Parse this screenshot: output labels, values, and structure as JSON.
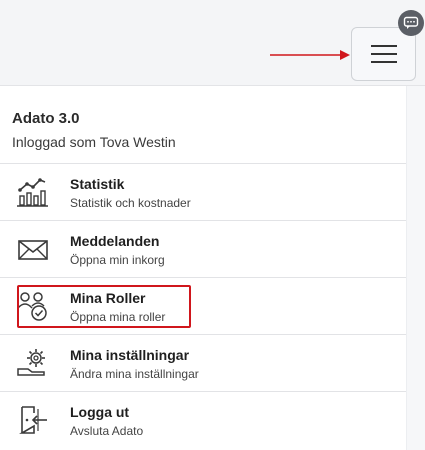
{
  "header": {
    "menu_button": "hamburger-menu",
    "chat_icon": "chat-icon",
    "annotation_arrow_color": "#d0161c"
  },
  "panel": {
    "app_title": "Adato 3.0",
    "logged_in_text": "Inloggad som Tova Westin",
    "items": [
      {
        "title": "Statistik",
        "subtitle": "Statistik och kostnader",
        "icon": "chart-icon"
      },
      {
        "title": "Meddelanden",
        "subtitle": "Öppna min inkorg",
        "icon": "envelope-icon"
      },
      {
        "title": "Mina Roller",
        "subtitle": "Öppna mina roller",
        "icon": "roles-icon"
      },
      {
        "title": "Mina inställningar",
        "subtitle": "Ändra mina inställningar",
        "icon": "settings-icon"
      },
      {
        "title": "Logga ut",
        "subtitle": "Avsluta Adato",
        "icon": "logout-icon"
      }
    ]
  },
  "colors": {
    "highlight": "#d0161c",
    "icon": "#3a3a3a"
  }
}
